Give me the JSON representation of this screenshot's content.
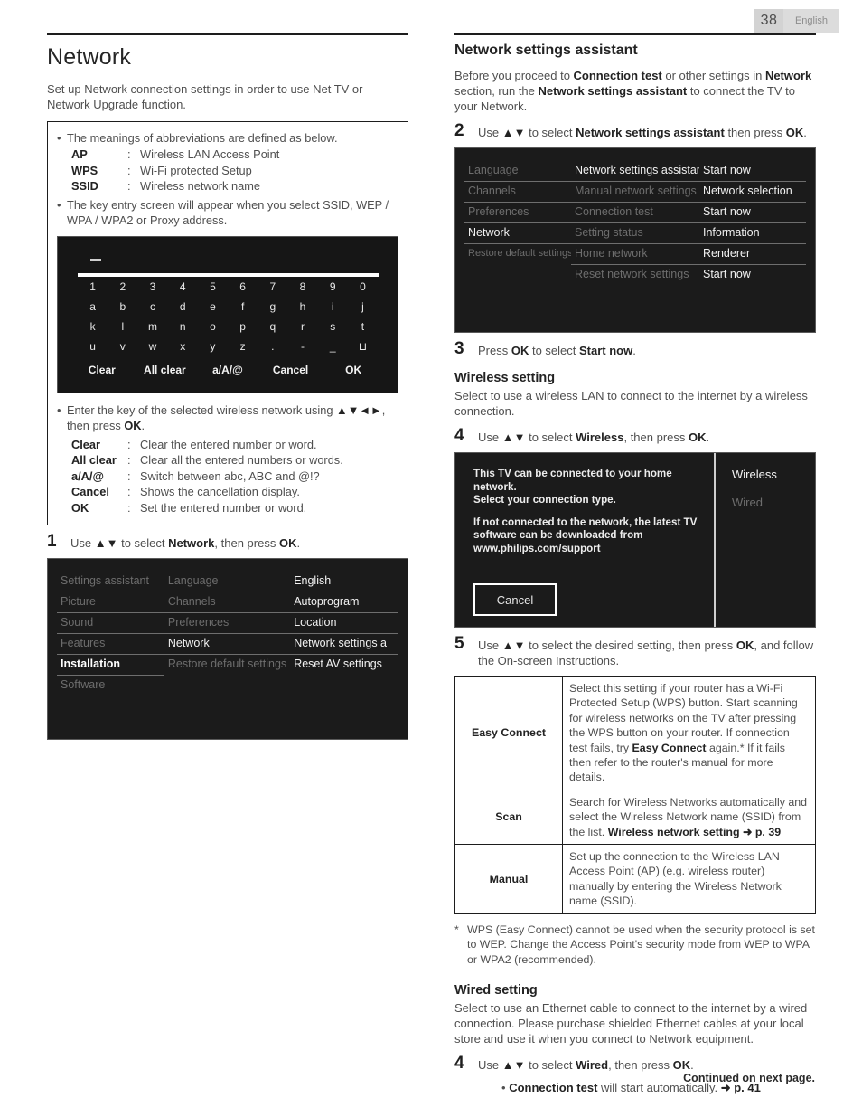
{
  "header": {
    "page_number": "38",
    "language": "English"
  },
  "left": {
    "title": "Network",
    "intro": "Set up Network connection settings in order to use Net TV or Network Upgrade function.",
    "infobox": {
      "bullet1": "The meanings of abbreviations are defined as below.",
      "abbreviations": [
        {
          "key": "AP",
          "sep": ":",
          "value": "Wireless LAN Access Point"
        },
        {
          "key": "WPS",
          "sep": ":",
          "value": "Wi-Fi protected Setup"
        },
        {
          "key": "SSID",
          "sep": ":",
          "value": "Wireless network name"
        }
      ],
      "bullet2": "The key entry screen will appear when you select SSID, WEP / WPA / WPA2 or Proxy address.",
      "keyboard": {
        "rows": [
          [
            "1",
            "2",
            "3",
            "4",
            "5",
            "6",
            "7",
            "8",
            "9",
            "0"
          ],
          [
            "a",
            "b",
            "c",
            "d",
            "e",
            "f",
            "g",
            "h",
            "i",
            "j"
          ],
          [
            "k",
            "l",
            "m",
            "n",
            "o",
            "p",
            "q",
            "r",
            "s",
            "t"
          ],
          [
            "u",
            "v",
            "w",
            "x",
            "y",
            "z",
            ".",
            "-",
            "_",
            "⊔"
          ]
        ],
        "functions": [
          "Clear",
          "All clear",
          "a/A/@",
          "Cancel",
          "OK"
        ]
      },
      "bullet3_a": "Enter the key of the selected wireless network using ",
      "bullet3_arrows": "▲▼◄►",
      "bullet3_b": ", then press ",
      "bullet3_ok": "OK",
      "bullet3_c": ".",
      "key_legend": [
        {
          "key": "Clear",
          "sep": ":",
          "value": "Clear the entered number or word."
        },
        {
          "key": "All clear",
          "sep": ":",
          "value": "Clear all the entered numbers or words."
        },
        {
          "key": "a/A/@",
          "sep": ":",
          "value": "Switch between abc, ABC and @!?"
        },
        {
          "key": "Cancel",
          "sep": ":",
          "value": "Shows the cancellation display."
        },
        {
          "key": "OK",
          "sep": ":",
          "value": "Set the entered number or word."
        }
      ]
    },
    "step1": {
      "num": "1",
      "a": "Use ",
      "arrows": "▲▼",
      "b": " to select ",
      "target": "Network",
      "c": ", then press ",
      "ok": "OK",
      "d": "."
    },
    "menu1": {
      "col1": [
        {
          "label": "Settings assistant",
          "state": "dim"
        },
        {
          "label": "Picture",
          "state": "dim"
        },
        {
          "label": "Sound",
          "state": "dim"
        },
        {
          "label": "Features",
          "state": "dim"
        },
        {
          "label": "Installation",
          "state": "sel"
        },
        {
          "label": "Software",
          "state": "dim"
        }
      ],
      "col2": [
        {
          "label": "Language",
          "state": "dim"
        },
        {
          "label": "Channels",
          "state": "dim"
        },
        {
          "label": "Preferences",
          "state": "dim"
        },
        {
          "label": "Network",
          "state": "bright"
        },
        {
          "label": "Restore default settings",
          "state": "dim"
        }
      ],
      "col3": [
        {
          "label": "English",
          "state": "bright"
        },
        {
          "label": "Autoprogram",
          "state": "bright"
        },
        {
          "label": "Location",
          "state": "bright"
        },
        {
          "label": "Network settings a",
          "state": "bright"
        },
        {
          "label": "Reset AV settings",
          "state": "bright"
        }
      ]
    }
  },
  "right": {
    "heading": "Network settings assistant",
    "intro_a": "Before you proceed to ",
    "intro_b1": "Connection test",
    "intro_c": " or other settings in ",
    "intro_b2": "Network",
    "intro_d": " section, run the ",
    "intro_b3": "Network settings assistant",
    "intro_e": " to connect the TV to your Network.",
    "step2": {
      "num": "2",
      "a": "Use ",
      "arrows": "▲▼",
      "b": " to select ",
      "target": "Network settings assistant",
      "c": " then press ",
      "ok": "OK",
      "d": "."
    },
    "menu2": {
      "col1": [
        {
          "label": "Language",
          "state": "dim"
        },
        {
          "label": "Channels",
          "state": "dim"
        },
        {
          "label": "Preferences",
          "state": "dim"
        },
        {
          "label": "Network",
          "state": "bright"
        },
        {
          "label": "Restore default settings",
          "state": "dim"
        }
      ],
      "col2": [
        {
          "label": "Network settings assistant",
          "state": "bright"
        },
        {
          "label": "Manual network settings",
          "state": "dim"
        },
        {
          "label": "Connection test",
          "state": "dim"
        },
        {
          "label": "Setting status",
          "state": "dim"
        },
        {
          "label": "Home network",
          "state": "dim"
        },
        {
          "label": "Reset network settings",
          "state": "dim"
        }
      ],
      "col3": [
        {
          "label": "Start now",
          "state": "bright"
        },
        {
          "label": "Network selection",
          "state": "bright"
        },
        {
          "label": "Start now",
          "state": "bright"
        },
        {
          "label": "Information",
          "state": "bright"
        },
        {
          "label": "Renderer",
          "state": "bright"
        },
        {
          "label": "Start now",
          "state": "bright"
        }
      ]
    },
    "step3": {
      "num": "3",
      "a": "Press ",
      "ok": "OK",
      "b": " to select ",
      "target": "Start now",
      "c": "."
    },
    "wireless_heading": "Wireless setting",
    "wireless_intro": "Select to use a wireless LAN to connect to the internet by a wireless connection.",
    "step4a": {
      "num": "4",
      "a": "Use ",
      "arrows": "▲▼",
      "b": " to select ",
      "target": "Wireless",
      "c": ", then press ",
      "ok": "OK",
      "d": "."
    },
    "tv3": {
      "para1": "This TV can be connected to your home network.\nSelect your connection type.",
      "para2": "If not connected to the network, the latest TV software can be downloaded from www.philips.com/support",
      "cancel": "Cancel",
      "options": [
        {
          "label": "Wireless",
          "state": "bright"
        },
        {
          "label": "Wired",
          "state": "dim"
        }
      ]
    },
    "step5": {
      "num": "5",
      "a": "Use ",
      "arrows": "▲▼",
      "b": " to select the desired setting, then press ",
      "ok": "OK",
      "c": ", and follow the On-screen Instructions."
    },
    "table": [
      {
        "label": "Easy Connect",
        "desc_a": "Select this setting if your router has a Wi-Fi Protected Setup (WPS) button. Start scanning for wireless networks on the TV after pressing the WPS button on your router. If connection test fails, try ",
        "desc_b": "Easy Connect",
        "desc_c": " again.* If it fails then refer to the router's manual for more details."
      },
      {
        "label": "Scan",
        "desc_a": "Search for Wireless Networks automatically and select the Wireless Network name (SSID) from the list. ",
        "desc_b": "Wireless network setting",
        "desc_arrow": "➜",
        "desc_c": " p. 39"
      },
      {
        "label": "Manual",
        "desc_a": "Set up the connection to the Wireless LAN Access Point (AP) (e.g. wireless router) manually by entering the Wireless Network name (SSID).",
        "desc_b": "",
        "desc_c": ""
      }
    ],
    "footnote_star": "*",
    "footnote": "WPS (Easy Connect) cannot be used when the security protocol is set to WEP. Change the Access Point's security mode from WEP to WPA or WPA2 (recommended).",
    "wired_heading": "Wired setting",
    "wired_intro": "Select to use an Ethernet cable to connect to the internet by a wired connection. Please purchase shielded Ethernet cables at your local store and use it when you connect to Network equipment.",
    "step4b": {
      "num": "4",
      "a": "Use ",
      "arrows": "▲▼",
      "b": " to select ",
      "target": "Wired",
      "c": ", then press ",
      "ok": "OK",
      "d": "."
    },
    "step4b_bullet_a": "Connection test",
    "step4b_bullet_b": " will start automatically. ",
    "step4b_bullet_arrow": "➜",
    "step4b_bullet_c": " p. 41",
    "continued": "Continued on next page."
  }
}
